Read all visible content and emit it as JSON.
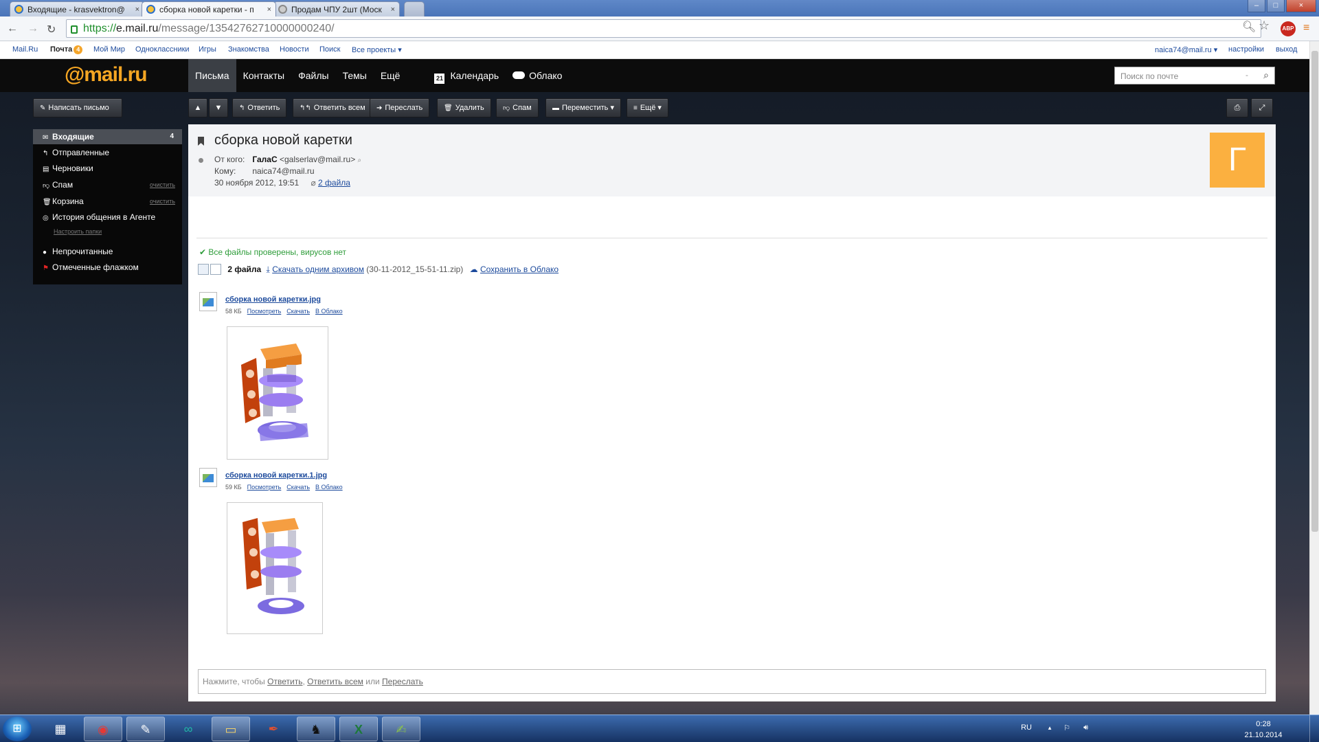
{
  "browser": {
    "tabs": [
      {
        "title": "Входящие - krasvektron@",
        "close": "×"
      },
      {
        "title": "сборка новой каретки - п",
        "close": "×"
      },
      {
        "title": "Продам ЧПУ 2шт (Моск",
        "close": "×"
      }
    ],
    "window_controls": {
      "minimize": "–",
      "maximize": "□",
      "close": "×"
    },
    "nav": {
      "back": "←",
      "forward": "→",
      "reload": "↻"
    },
    "url": {
      "scheme": "https://",
      "host": "e.mail.ru",
      "path": "/message/13542762710000000240/"
    },
    "icons": {
      "zoom": "🔍︎",
      "star": "☆",
      "abp": "ABP",
      "menu": "≡"
    }
  },
  "portal": {
    "links": [
      "Mail.Ru",
      "Почта",
      "Мой Мир",
      "Одноклассники",
      "Игры",
      "Знакомства",
      "Новости",
      "Поиск",
      "Все проекты ▾"
    ],
    "mail_badge": "4",
    "user": "naica74@mail.ru ▾",
    "settings": "настройки",
    "logout": "выход"
  },
  "header": {
    "logo_at": "@mail",
    "logo_dot": ".ru",
    "nav": [
      "Письма",
      "Контакты",
      "Файлы",
      "Темы",
      "Ещё"
    ],
    "calendar_icon": "21",
    "calendar": "Календарь",
    "cloud": "Облако",
    "search_placeholder": "Поиск по почте",
    "search_dash": "-",
    "search_icon": "⌕"
  },
  "toolbar": {
    "compose": "Написать письмо",
    "prev": "▲",
    "next": "▼",
    "reply": "Ответить",
    "reply_all": "Ответить всем",
    "forward": "Переслать",
    "delete": "Удалить",
    "spam": "Спам",
    "move": "Переместить ▾",
    "more": "Ещё ▾",
    "icons": {
      "compose": "✎",
      "reply": "↰",
      "reply_all": "↰↰",
      "forward": "➔",
      "delete": "🗑︎",
      "spam": "👎︎",
      "move": "▬",
      "more": "≡",
      "print": "⎙",
      "expand": "⤢"
    }
  },
  "sidebar": {
    "folders": [
      {
        "label": "Входящие",
        "icon": "✉",
        "count": "4"
      },
      {
        "label": "Отправленные",
        "icon": "↰"
      },
      {
        "label": "Черновики",
        "icon": "▤"
      },
      {
        "label": "Спам",
        "icon": "👎︎",
        "clear": "очистить"
      },
      {
        "label": "Корзина",
        "icon": "🗑︎",
        "clear": "очистить"
      },
      {
        "label": "История общения в Агенте",
        "icon": "◎"
      }
    ],
    "setup_folders": "Настроить папки",
    "filters": [
      {
        "label": "Непрочитанные",
        "icon": "●"
      },
      {
        "label": "Отмеченные флажком",
        "icon": "⚑"
      }
    ]
  },
  "message": {
    "subject": "сборка новой каретки",
    "from_label": "От кого:",
    "from_name": "ГалаС",
    "from_email": "<galserlav@mail.ru>",
    "from_search": "⌕",
    "to_label": "Кому:",
    "to": "naica74@mail.ru",
    "date": "30 ноября 2012, 19:51",
    "clip": "⌀",
    "attachments_link": "2 файла",
    "avatar_letter": "Г",
    "virus_check": "Все файлы проверены, вирусов нет",
    "files_count": "2 файла",
    "download_all": "Скачать одним архивом",
    "archive_name": "(30-11-2012_15-51-11.zip)",
    "save_cloud": "Сохранить в Облако",
    "attachments": [
      {
        "name": "сборка новой каретки.jpg",
        "size": "58 КБ",
        "view": "Посмотреть",
        "download": "Скачать",
        "cloud": "В Облако"
      },
      {
        "name": "сборка новой каретки.1.jpg",
        "size": "59 КБ",
        "view": "Посмотреть",
        "download": "Скачать",
        "cloud": "В Облако"
      }
    ],
    "reply_prompt": "Нажмите, чтобы",
    "reply_links": [
      "Ответить",
      "Ответить всем",
      "Переслать"
    ],
    "reply_sep": ",",
    "reply_or": "или"
  },
  "taskbar": {
    "start": "⊞",
    "apps": [
      {
        "name": "calculator",
        "glyph": "▦"
      },
      {
        "name": "chrome",
        "glyph": "◉"
      },
      {
        "name": "notepad",
        "glyph": "✎"
      },
      {
        "name": "arduino",
        "glyph": "∞"
      },
      {
        "name": "explorer",
        "glyph": "▭"
      },
      {
        "name": "pen",
        "glyph": "✒"
      },
      {
        "name": "inkscape",
        "glyph": "♞"
      },
      {
        "name": "excel",
        "glyph": "X"
      },
      {
        "name": "editor",
        "glyph": "✍"
      }
    ],
    "lang": "RU",
    "tray_up": "▲",
    "tray_flag": "⚐",
    "tray_sound": "🔊︎",
    "time": "0:28",
    "date": "21.10.2014"
  },
  "colors": {
    "accent": "#f5a623",
    "link": "#1c4a9c",
    "ok_green": "#2e9c3a",
    "avatar_bg": "#fbb040"
  }
}
